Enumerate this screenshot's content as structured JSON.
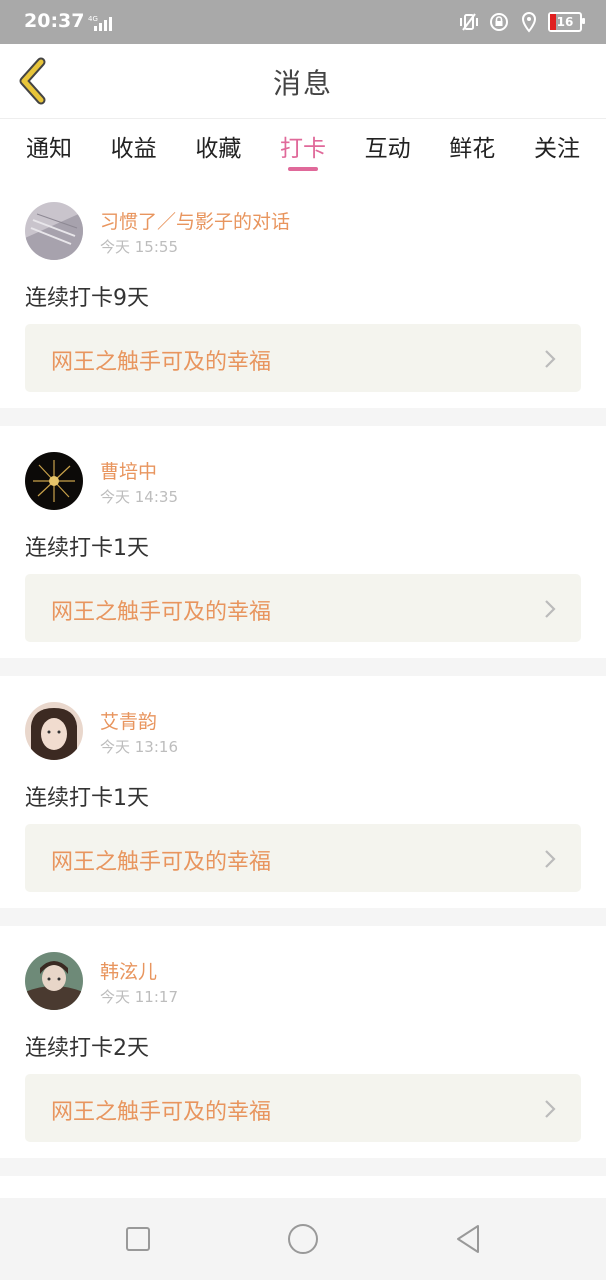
{
  "status_bar": {
    "time": "20:37",
    "network": "4G",
    "battery": "16",
    "icons": [
      "vibrate-icon",
      "alarm-lock-icon",
      "location-icon",
      "battery-icon"
    ]
  },
  "header": {
    "title": "消息",
    "back_icon": "chevron-left-icon",
    "back_color": "#e8c53a"
  },
  "tabs": [
    {
      "label": "通知",
      "active": false
    },
    {
      "label": "收益",
      "active": false
    },
    {
      "label": "收藏",
      "active": false
    },
    {
      "label": "打卡",
      "active": true
    },
    {
      "label": "互动",
      "active": false
    },
    {
      "label": "鲜花",
      "active": false
    },
    {
      "label": "关注",
      "active": false
    }
  ],
  "messages": [
    {
      "user": "习惯了／与影子的对话",
      "time": "今天 15:55",
      "text": "连续打卡9天",
      "book": "网王之触手可及的幸福"
    },
    {
      "user": "曹培中",
      "time": "今天 14:35",
      "text": "连续打卡1天",
      "book": "网王之触手可及的幸福"
    },
    {
      "user": "艾青韵",
      "time": "今天 13:16",
      "text": "连续打卡1天",
      "book": "网王之触手可及的幸福"
    },
    {
      "user": "韩泫儿",
      "time": "今天 11:17",
      "text": "连续打卡2天",
      "book": "网王之触手可及的幸福"
    }
  ],
  "colors": {
    "accent": "#e0699a",
    "name": "#e8955e",
    "book_bg": "#f4f4ee"
  },
  "navbar": {
    "icons": [
      "recent-apps-icon",
      "home-icon",
      "back-icon"
    ]
  }
}
